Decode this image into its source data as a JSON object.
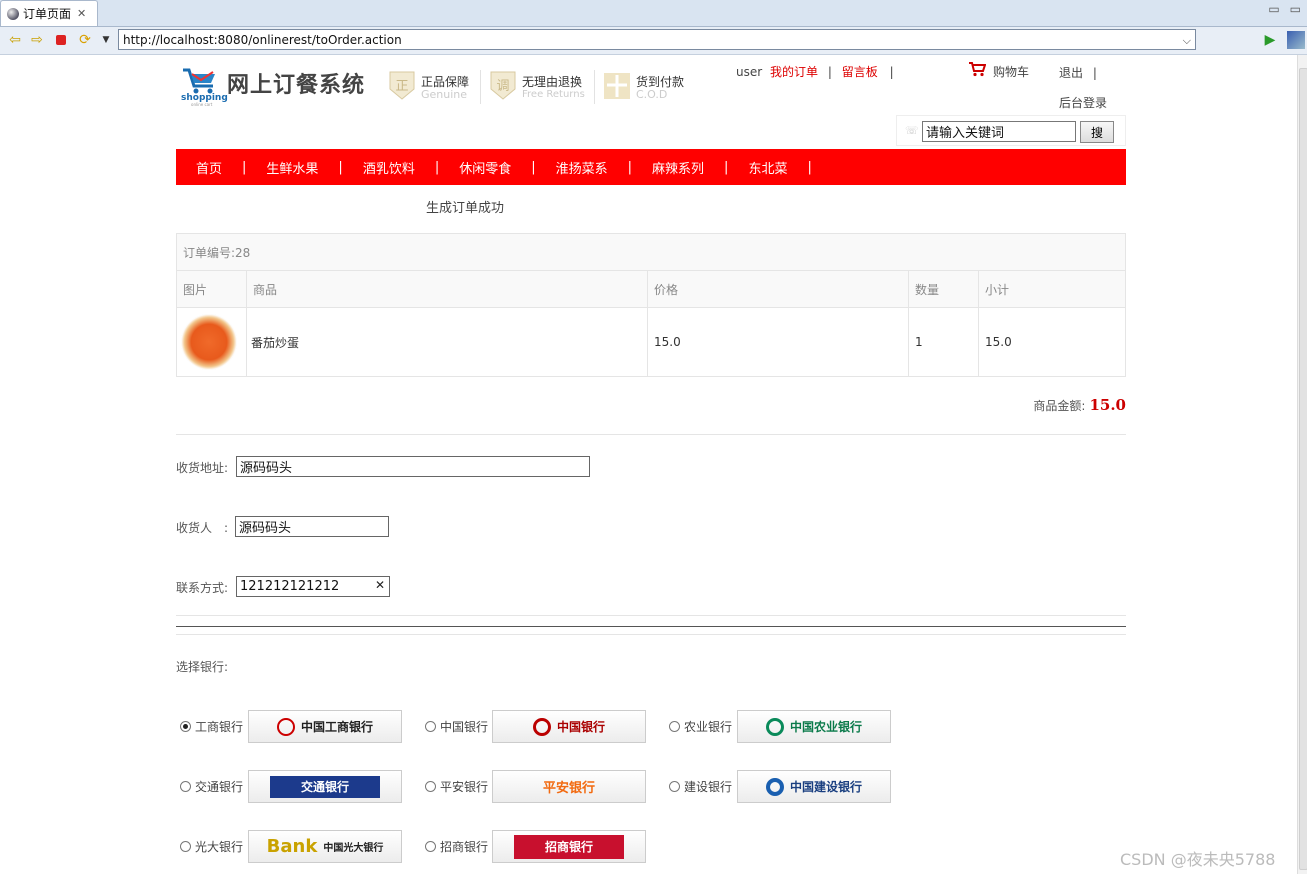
{
  "browser": {
    "tab_title": "订单页面",
    "url": "http://localhost:8080/onlinerest/toOrder.action"
  },
  "header": {
    "logo_small": "shopping",
    "logo_sub": "online cart",
    "site_title": "网上订餐系统",
    "features": [
      {
        "title": "正品保障",
        "sub": "Genuine",
        "icon": "genuine-badge-icon"
      },
      {
        "title": "无理由退换",
        "sub": "Free Returns",
        "icon": "returns-badge-icon"
      },
      {
        "title": "货到付款",
        "sub": "C.O.D",
        "icon": "cod-badge-icon"
      }
    ],
    "user": "user",
    "my_orders": "我的订单",
    "message_board": "留言板",
    "cart": "购物车",
    "logout": "退出",
    "admin_login": "后台登录",
    "search_placeholder": "请输入关键词",
    "search_button": "搜"
  },
  "nav": {
    "items": [
      "首页",
      "生鲜水果",
      "酒乳饮料",
      "休闲零食",
      "淮扬菜系",
      "麻辣系列",
      "东北菜"
    ]
  },
  "order": {
    "success_msg": "生成订单成功",
    "order_no": "订单编号:28",
    "columns": [
      "图片",
      "商品",
      "价格",
      "数量",
      "小计"
    ],
    "rows": [
      {
        "image": "tomato-egg-dish",
        "name": "番茄炒蛋",
        "price": "15.0",
        "qty": "1",
        "subtotal": "15.0"
      }
    ],
    "total_label": "商品金额:",
    "total_value": "15.0"
  },
  "form": {
    "address_label": "收货地址:",
    "address_value": "源码码头",
    "receiver_label": "收货人　:",
    "receiver_value": "源码码头",
    "phone_label": "联系方式:",
    "phone_value": "121212121212"
  },
  "bank": {
    "label": "选择银行:",
    "options": [
      {
        "name": "工商银行",
        "logo": "中国工商银行",
        "selected": true
      },
      {
        "name": "中国银行",
        "logo": "中国银行",
        "selected": false
      },
      {
        "name": "农业银行",
        "logo": "中国农业银行",
        "selected": false
      },
      {
        "name": "交通银行",
        "logo": "交通银行",
        "selected": false
      },
      {
        "name": "平安银行",
        "logo": "平安银行",
        "selected": false
      },
      {
        "name": "建设银行",
        "logo": "中国建设银行",
        "selected": false
      },
      {
        "name": "光大银行",
        "logo": "中国光大银行",
        "selected": false
      },
      {
        "name": "招商银行",
        "logo": "招商银行",
        "selected": false
      }
    ]
  },
  "watermark": "CSDN @夜未央5788",
  "colors": {
    "accent_red": "#ff0000",
    "link_red": "#dd0000",
    "total_red": "#cc0000"
  }
}
